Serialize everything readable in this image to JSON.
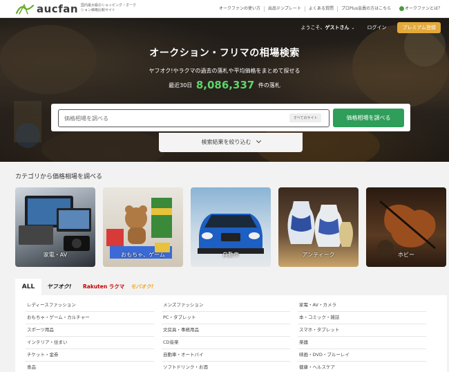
{
  "header": {
    "logo_text": "aucfan",
    "logo_sub": "国内最大級のショッピング・オークション価格比較サイト",
    "nav": [
      "オークファンの使い方",
      "出品テンプレート",
      "よくある質問",
      "プロPlus会員の方はこちら"
    ],
    "about": "オークファンとは？"
  },
  "hero": {
    "welcome_prefix": "ようこそ、",
    "guest_name": "ゲストさん",
    "login": "ログイン",
    "premium": "プレミアム登録",
    "title": "オークション・フリマの相場検索",
    "subtitle": "ヤフオク!やラクマの過去の落札や平均価格をまとめて探せる",
    "count_prefix": "最近30日",
    "count_value": "8,086,337",
    "count_suffix": "件の落札",
    "search_placeholder": "価格相場を調べる",
    "all_sites": "すべてのサイト",
    "search_button": "価格相場を調べる",
    "narrow": "検索結果を絞り込む"
  },
  "categories": {
    "heading": "カテゴリから価格相場を調べる",
    "items": [
      {
        "label": "家電・AV"
      },
      {
        "label": "おもちゃ、ゲーム"
      },
      {
        "label": "自動車"
      },
      {
        "label": "アンティーク"
      },
      {
        "label": "ホビー"
      }
    ]
  },
  "site_tabs": {
    "all": "ALL",
    "yahoo": "ヤフオク!",
    "rakuten": "Rakuten ラクマ",
    "mobaoku": "モバオク!"
  },
  "category_list": {
    "col1": [
      "レディースファッション",
      "おもちゃ・ゲーム・カルチャー",
      "スポーツ用品",
      "インテリア・住まい",
      "チケット・金券",
      "食品"
    ],
    "col2": [
      "メンズファッション",
      "PC・タブレット",
      "文房具・事務用品",
      "CD音楽",
      "自動車・オートバイ",
      "ソフトドリンク・お酒"
    ],
    "col3": [
      "家電・AV・カメラ",
      "本・コミック・雑誌",
      "スマホ・タブレット",
      "楽器",
      "映画・DVD・ブルーレイ",
      "健康・ヘルスケア"
    ]
  },
  "colors": {
    "accent_green": "#2e9e5a",
    "premium": "#e3a93a",
    "count_green": "#5cd56a",
    "rakuten_red": "#bf0000",
    "mobaoku_orange": "#f5a623"
  }
}
